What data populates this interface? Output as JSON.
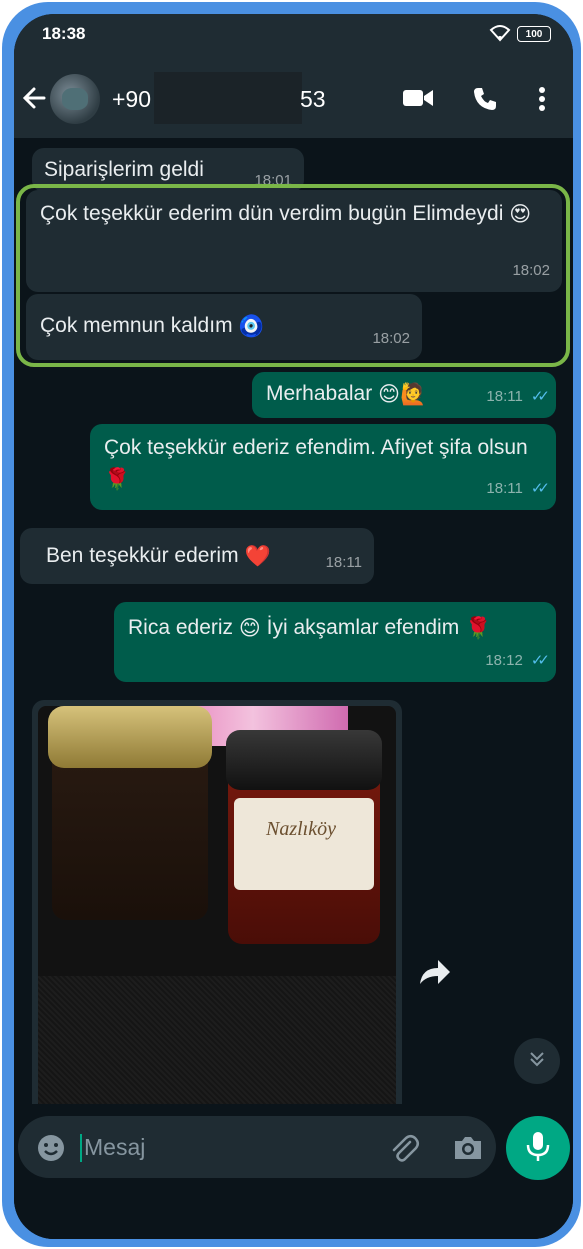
{
  "status_bar": {
    "time": "18:38",
    "battery": "100"
  },
  "header": {
    "phone_prefix": "+90",
    "phone_suffix": "53"
  },
  "messages": [
    {
      "text": "Siparişlerim geldi",
      "time": "18:01"
    },
    {
      "text": "Çok teşekkür ederim dün verdim bugün Elimdeydi",
      "emoji": "😍",
      "time": "18:02"
    },
    {
      "text": "Çok memnun kaldım",
      "emoji": "🧿",
      "time": "18:02"
    },
    {
      "text": "Merhabalar",
      "emoji": "😊🙋",
      "time": "18:11"
    },
    {
      "text": "Çok teşekkür ederiz efendim. Afiyet şifa olsun",
      "emoji": "🌹",
      "time": "18:11"
    },
    {
      "text": "Ben teşekkür ederim",
      "emoji": "❤️",
      "time": "18:11"
    },
    {
      "text": "Rica ederiz",
      "emoji": "😊",
      "text2": "İyi akşamlar efendim",
      "emoji2": "🌹",
      "time": "18:12"
    }
  ],
  "photo": {
    "jar_label_text": "Nazlıköy"
  },
  "composer": {
    "placeholder": "Mesaj"
  },
  "icons": {
    "back": "arrow-left-icon",
    "video": "video-call-icon",
    "call": "phone-icon",
    "menu": "more-vert-icon",
    "emoji": "emoji-icon",
    "attach": "paperclip-icon",
    "camera": "camera-icon",
    "mic": "microphone-icon",
    "forward": "forward-icon",
    "scroll_down": "chevron-double-down-icon"
  },
  "colors": {
    "incoming_bubble": "#1f2c33",
    "outgoing_bubble": "#005c4b",
    "accent": "#00a884",
    "read_ticks": "#53bdeb",
    "highlight_border": "#7ab648",
    "phone_frame": "#4a90e2"
  }
}
